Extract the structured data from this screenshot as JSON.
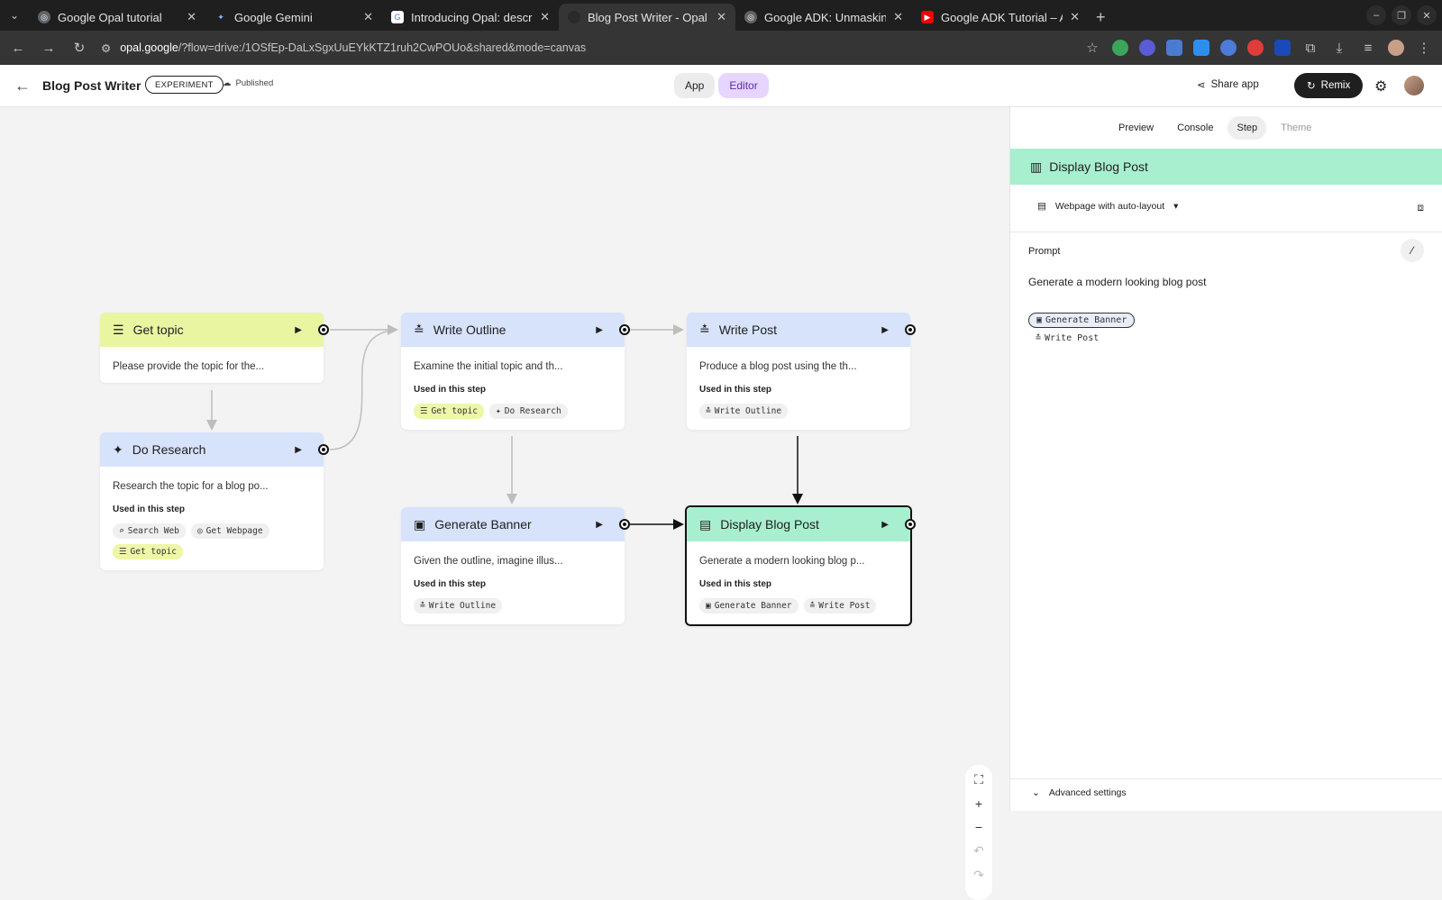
{
  "browser": {
    "tabs": [
      {
        "title": "Google Opal tutorial",
        "icon": "globe-icon",
        "active": false
      },
      {
        "title": "Google Gemini",
        "icon": "gemini-icon",
        "active": false
      },
      {
        "title": "Introducing Opal: descri",
        "icon": "g-icon",
        "active": false
      },
      {
        "title": "Blog Post Writer - Opal [",
        "icon": "opal-icon",
        "active": true
      },
      {
        "title": "Google ADK: Unmasking",
        "icon": "globe-icon",
        "active": false
      },
      {
        "title": "Google ADK Tutorial – A",
        "icon": "youtube-icon",
        "active": false
      }
    ],
    "url_host": "opal.google",
    "url_path": "/?flow=drive:/1OSfEp-DaLxSgxUuEYkKTZ1ruh2CwPOUo&shared&mode=canvas"
  },
  "header": {
    "title": "Blog Post Writer",
    "badge": "EXPERIMENT",
    "status": "Published",
    "mode_app": "App",
    "mode_editor": "Editor",
    "share_label": "Share app",
    "remix_label": "Remix"
  },
  "nodes": {
    "get_topic": {
      "title": "Get topic",
      "desc": "Please provide the topic for the..."
    },
    "do_research": {
      "title": "Do Research",
      "desc": "Research the topic for a blog po...",
      "used_label": "Used in this step",
      "chips": [
        "Search Web",
        "Get Webpage",
        "Get topic"
      ]
    },
    "write_outline": {
      "title": "Write Outline",
      "desc": "Examine the initial topic and th...",
      "used_label": "Used in this step",
      "chips": [
        "Get topic",
        "Do Research"
      ]
    },
    "write_post": {
      "title": "Write Post",
      "desc": "Produce a blog post using the th...",
      "used_label": "Used in this step",
      "chips": [
        "Write Outline"
      ]
    },
    "generate_banner": {
      "title": "Generate Banner",
      "desc": "Given the outline, imagine illus...",
      "used_label": "Used in this step",
      "chips": [
        "Write Outline"
      ]
    },
    "display_blog_post": {
      "title": "Display Blog Post",
      "desc": "Generate a modern looking blog p...",
      "used_label": "Used in this step",
      "chips": [
        "Generate Banner",
        "Write Post"
      ]
    }
  },
  "panel": {
    "tabs": [
      "Preview",
      "Console",
      "Step",
      "Theme"
    ],
    "active_tab": "Step",
    "step_title": "Display Blog Post",
    "layout_select": "Webpage with auto-layout",
    "prompt_label": "Prompt",
    "prompt_text": "Generate a modern looking blog post",
    "prompt_chips": [
      "Generate Banner",
      "Write Post"
    ],
    "advanced_label": "Advanced settings"
  },
  "colors": {
    "input_node": "#eaf5a2",
    "generate_node": "#d7e2fb",
    "output_node": "#a8efcf",
    "editor_accent": "#e6d5ff"
  }
}
